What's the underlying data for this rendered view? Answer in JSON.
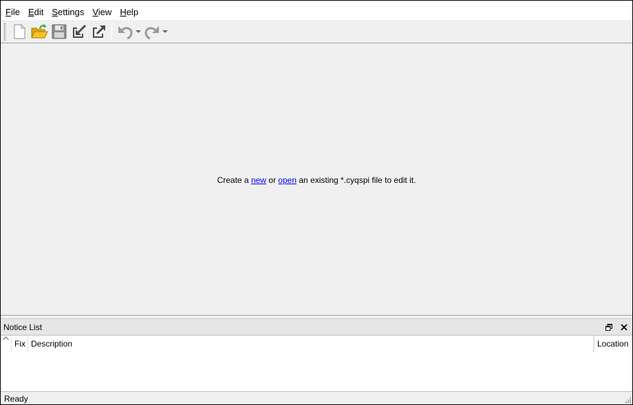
{
  "menu": {
    "items": [
      {
        "label": "File",
        "mnemonic": "F",
        "rest": "ile"
      },
      {
        "label": "Edit",
        "mnemonic": "E",
        "rest": "dit"
      },
      {
        "label": "Settings",
        "mnemonic": "S",
        "rest": "ettings"
      },
      {
        "label": "View",
        "mnemonic": "V",
        "rest": "iew"
      },
      {
        "label": "Help",
        "mnemonic": "H",
        "rest": "elp"
      }
    ]
  },
  "toolbar": {
    "icons": [
      "new-file-icon",
      "open-folder-icon",
      "save-icon",
      "import-icon",
      "export-icon",
      "undo-icon",
      "redo-icon"
    ],
    "accent_folder": "#f5c22b",
    "accent_open_arrow": "#3cab3c",
    "disabled_gray": "#9a9a9a"
  },
  "central": {
    "prefix": "Create a ",
    "link_new": "new",
    "middle": " or ",
    "link_open": "open",
    "suffix": " an existing *.cyqspi file to edit it.",
    "link_color": "#0000ee"
  },
  "notice_list": {
    "title": "Notice List",
    "columns": {
      "fix": "Fix",
      "description": "Description",
      "location": "Location"
    }
  },
  "status": {
    "text": "Ready"
  }
}
